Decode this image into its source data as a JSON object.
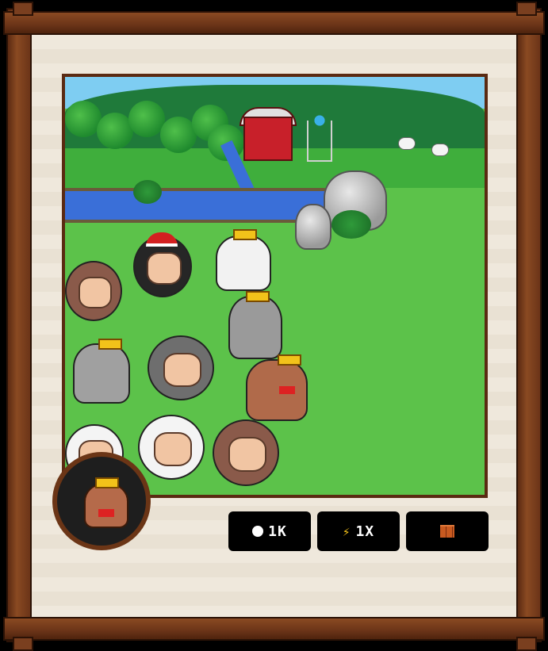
{
  "hud": {
    "coins_value": "1K",
    "speed_value": "1X",
    "coins_icon": "coin-icon",
    "speed_icon": "lightning-bolt-icon",
    "build_icon": "brick-icon"
  },
  "colors": {
    "frame_wood": "#7a3f1f",
    "canvas": "#efe8dc",
    "grass": "#5cc24a",
    "hud_bg": "#000000",
    "bolt": "#f4c21a"
  },
  "scene": {
    "elements": [
      "barn",
      "windmill",
      "river",
      "trees",
      "rocks",
      "sheep",
      "dogs"
    ]
  }
}
